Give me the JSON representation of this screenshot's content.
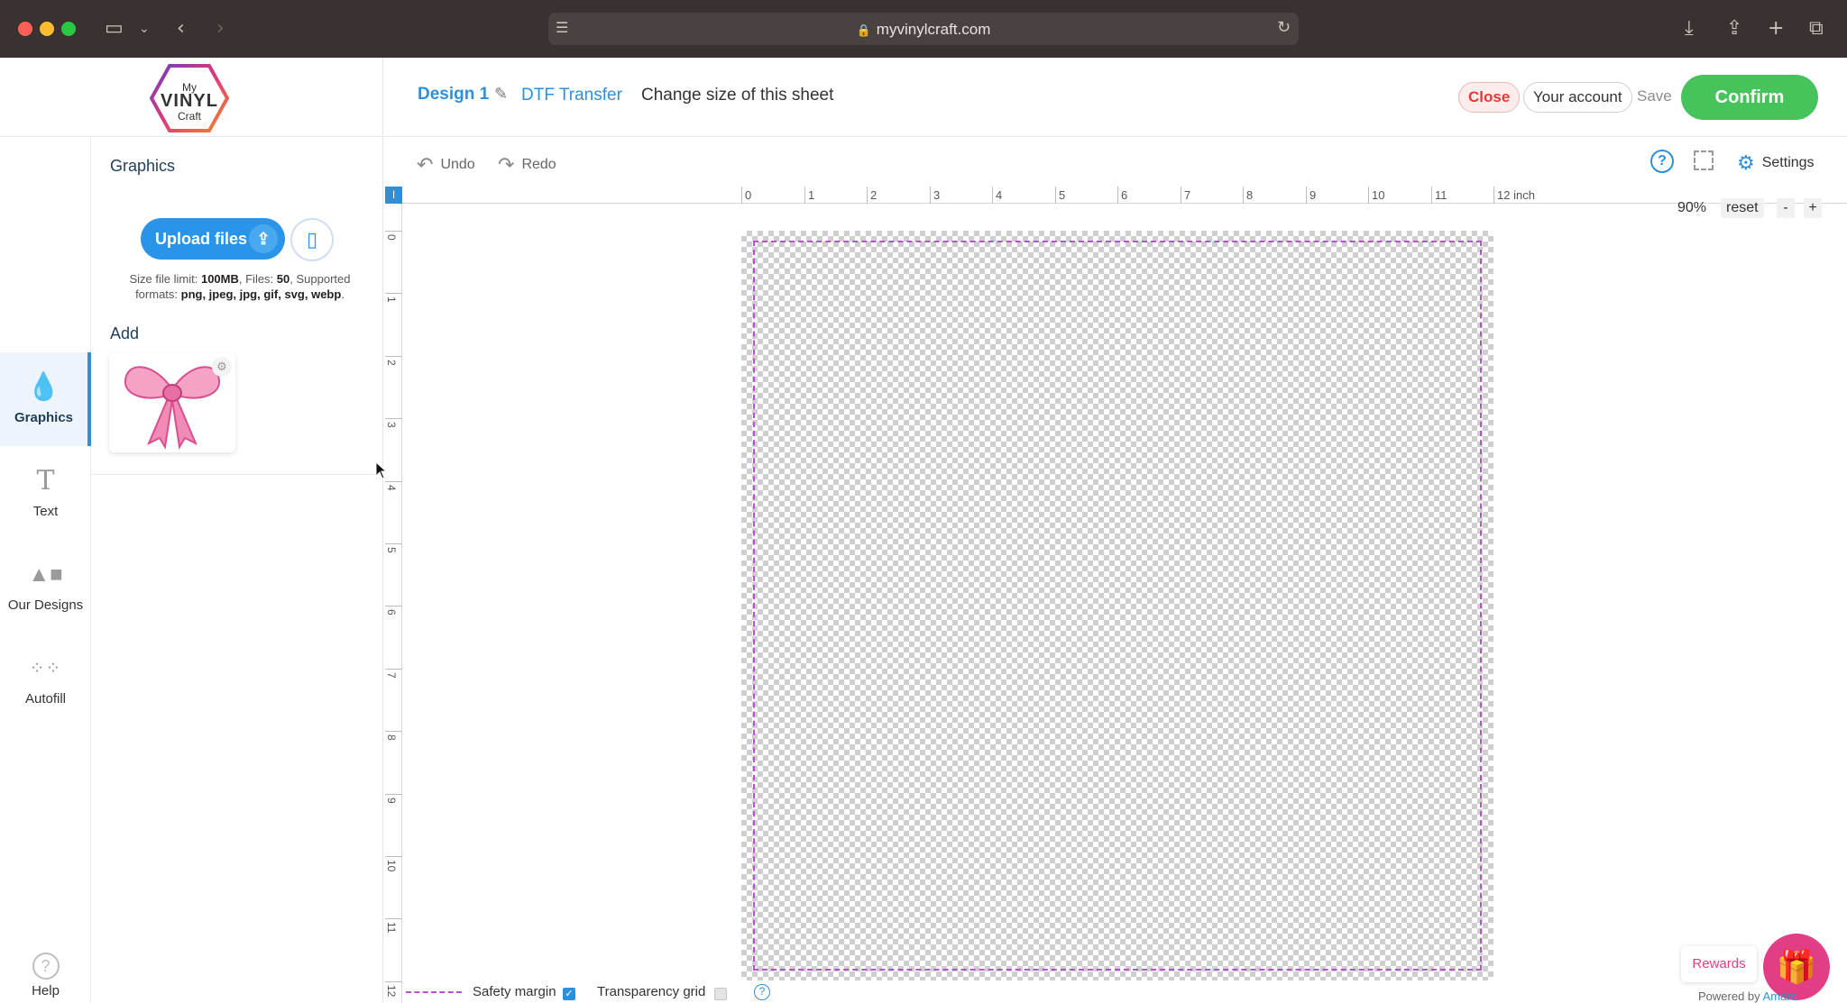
{
  "browser": {
    "url": "myvinylcraft.com"
  },
  "logo": {
    "line1": "My",
    "line2": "VINYL",
    "line3": "Craft"
  },
  "header": {
    "design_name": "Design 1",
    "product": "DTF Transfer",
    "change_size": "Change size of this sheet",
    "close_label": "Close",
    "account_label": "Your account",
    "save_label": "Save",
    "confirm_label": "Confirm"
  },
  "rail": {
    "items": [
      {
        "label": "Graphics",
        "icon": "drop-icon"
      },
      {
        "label": "Text",
        "icon": "text-icon"
      },
      {
        "label": "Our Designs",
        "icon": "shapes-icon"
      },
      {
        "label": "Autofill",
        "icon": "grid-dots-icon"
      }
    ],
    "help_label": "Help"
  },
  "panel": {
    "title": "Graphics",
    "upload_label": "Upload files",
    "file_info_prefix": "Size file limit: ",
    "file_limit": "100MB",
    "files_prefix": ", Files: ",
    "files_count": "50",
    "formats_prefix": ", Supported formats: ",
    "formats": "png, jpeg, jpg, gif, svg, webp",
    "formats_suffix": ".",
    "add_title": "Add"
  },
  "toolbar": {
    "undo_label": "Undo",
    "redo_label": "Redo",
    "settings_label": "Settings"
  },
  "zoom": {
    "value": "90%",
    "reset_label": "reset",
    "minus_label": "-",
    "plus_label": "+"
  },
  "ruler": {
    "corner_label": "I",
    "top_labels": [
      "0",
      "1",
      "2",
      "3",
      "4",
      "5",
      "6",
      "7",
      "8",
      "9",
      "10",
      "11",
      "12 inch"
    ],
    "left_labels": [
      "0",
      "1",
      "2",
      "3",
      "4",
      "5",
      "6",
      "7",
      "8",
      "9",
      "10",
      "11",
      "12"
    ]
  },
  "bottom": {
    "safety_label": "Safety margin",
    "safety_checked": true,
    "transparency_label": "Transparency grid",
    "transparency_checked": false
  },
  "rewards": {
    "label": "Rewards",
    "powered_prefix": "Powered by ",
    "powered_brand": "Amaro"
  },
  "colors": {
    "accent": "#2f8fd8",
    "confirm": "#46c35a",
    "close": "#e53935",
    "safety_margin": "#b94fd6",
    "rewards": "#e23e85"
  }
}
